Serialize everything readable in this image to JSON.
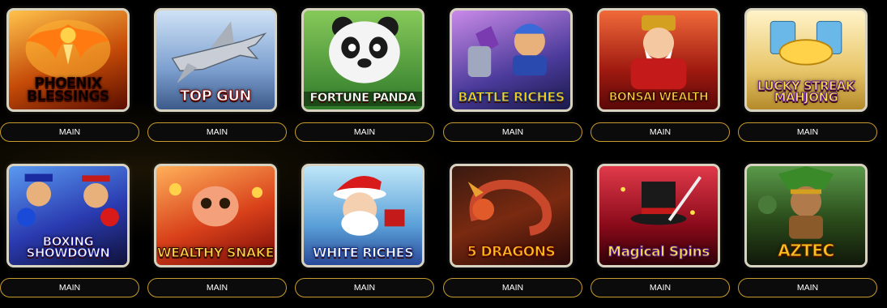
{
  "games": [
    {
      "title": "PHOENIX BLESSINGS",
      "button_label": "MAIN",
      "icon": "phoenix-art",
      "colors": {
        "bg1": "#ff9a1a",
        "bg2": "#7a1500",
        "text": "#ffd640"
      }
    },
    {
      "title": "TOP GUN",
      "button_label": "MAIN",
      "icon": "fighter-jet-art",
      "colors": {
        "bg1": "#9fc3e8",
        "bg2": "#5a7fb0",
        "text": "#ffffff"
      }
    },
    {
      "title": "FORTUNE PANDA",
      "button_label": "MAIN",
      "icon": "panda-art",
      "colors": {
        "bg1": "#6bbf4a",
        "bg2": "#1d5a1a",
        "text": "#ffffff"
      }
    },
    {
      "title": "BATTLE RICHES",
      "button_label": "MAIN",
      "icon": "warrior-art",
      "colors": {
        "bg1": "#b36ad8",
        "bg2": "#3a2a7a",
        "text": "#ffd21a"
      }
    },
    {
      "title": "BONSAI WEALTH",
      "button_label": "MAIN",
      "icon": "god-of-wealth-art",
      "colors": {
        "bg1": "#e8452a",
        "bg2": "#7a0a0a",
        "text": "#ffd640"
      }
    },
    {
      "title": "LUCKY STREAK MAHJONG",
      "button_label": "MAIN",
      "icon": "mahjong-art",
      "colors": {
        "bg1": "#ffe9a0",
        "bg2": "#d4a83a",
        "text": "#ffe14a"
      }
    },
    {
      "title": "BOXING SHOWDOWN",
      "button_label": "MAIN",
      "icon": "boxers-art",
      "colors": {
        "bg1": "#2a6ad8",
        "bg2": "#141850",
        "text": "#ffffff"
      }
    },
    {
      "title": "WEALTHY SNAKE",
      "button_label": "MAIN",
      "icon": "snake-art",
      "colors": {
        "bg1": "#ff7a2a",
        "bg2": "#9a1a0a",
        "text": "#ffd640"
      }
    },
    {
      "title": "WHITE RICHES",
      "button_label": "MAIN",
      "icon": "santa-art",
      "colors": {
        "bg1": "#8fd0f0",
        "bg2": "#2a5aa8",
        "text": "#ffffff"
      }
    },
    {
      "title": "5 DRAGONS",
      "button_label": "MAIN",
      "icon": "dragon-art",
      "colors": {
        "bg1": "#c9472a",
        "bg2": "#4a0a0a",
        "text": "#ffc21a"
      }
    },
    {
      "title": "Magical Spins",
      "button_label": "MAIN",
      "icon": "magic-hat-art",
      "colors": {
        "bg1": "#c81a3a",
        "bg2": "#3a0010",
        "text": "#ffe14a"
      }
    },
    {
      "title": "AZTEC",
      "button_label": "MAIN",
      "icon": "aztec-warrior-art",
      "colors": {
        "bg1": "#4a8a3a",
        "bg2": "#1a2a10",
        "text": "#ffc21a"
      }
    }
  ]
}
